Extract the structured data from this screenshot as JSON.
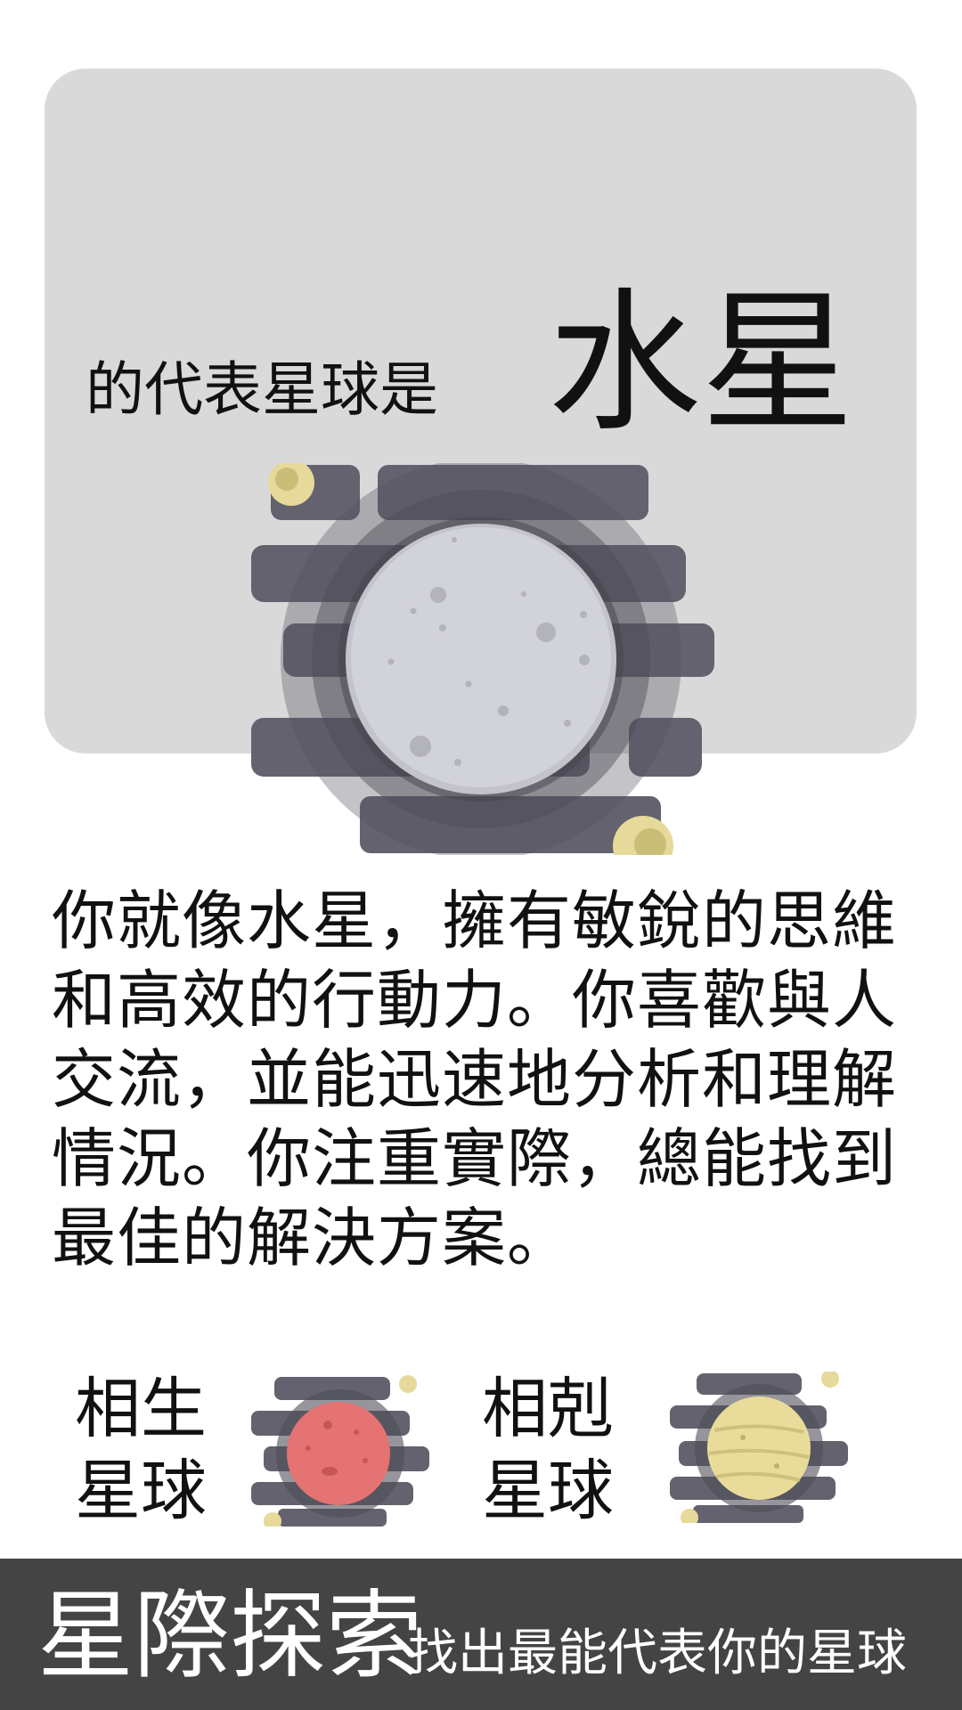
{
  "result": {
    "subtitle": "的代表星球是",
    "planet_name": "水星",
    "planet_icon": "mercury-icon",
    "description": "你就像水星，擁有敏銳的思維和高效的行動力。你喜歡與人交流，並能迅速地分析和理解情況。你注重實際，總能找到最佳的解決方案。"
  },
  "relations": {
    "compatible": {
      "label_line1": "相生",
      "label_line2": "星球",
      "icon": "mars-icon"
    },
    "incompatible": {
      "label_line1": "相剋",
      "label_line2": "星球",
      "icon": "venus-icon"
    }
  },
  "footer": {
    "brand": "星際探索",
    "tagline": "找出最能代表你的星球"
  },
  "colors": {
    "card_bg": "#d9d9d9",
    "footer_bg": "#444444",
    "space_stripes": "#5f5e6b",
    "mercury": "#ccccd4",
    "mars": "#e57373",
    "venus": "#e9dc9a"
  }
}
